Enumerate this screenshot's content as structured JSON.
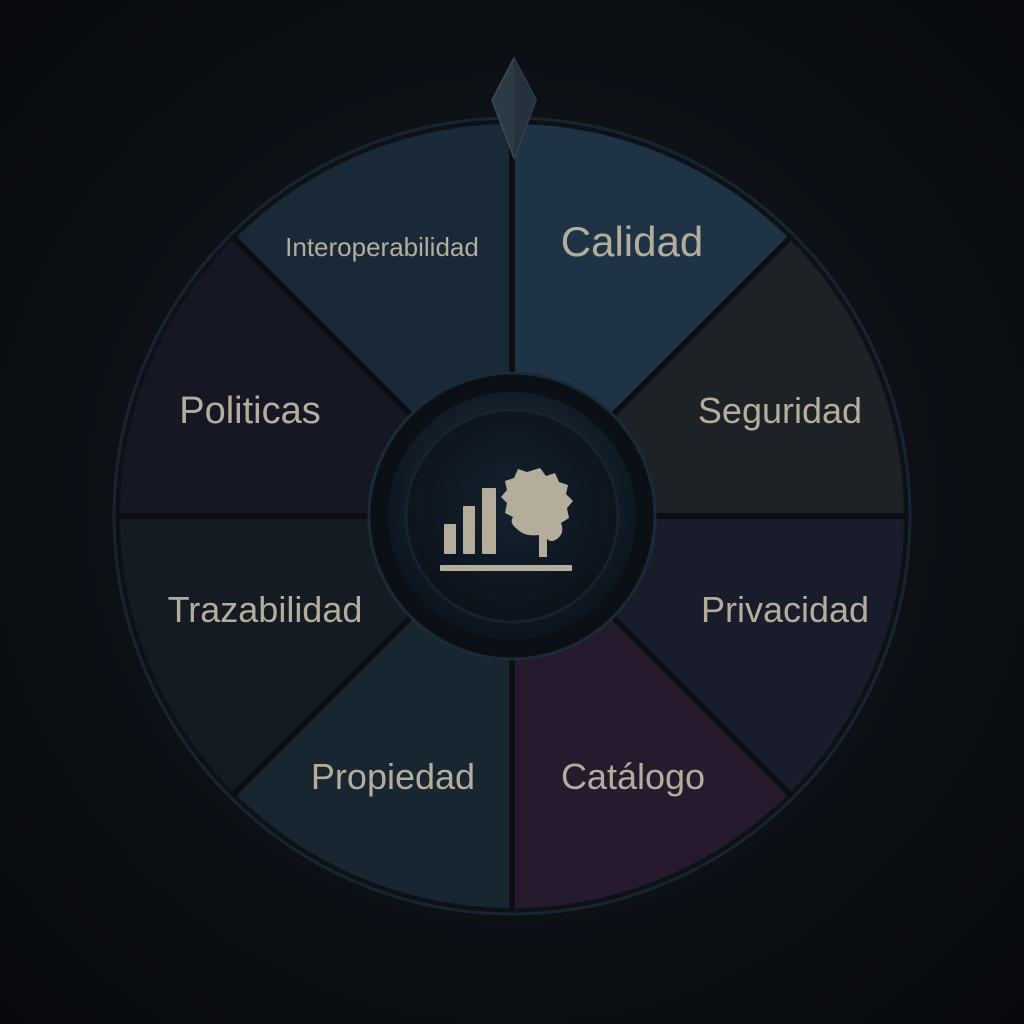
{
  "wheel": {
    "pointer_icon": "pointer-arrow-icon",
    "center_icon": "analytics-brain-gear-icon",
    "segments": [
      {
        "label": "Calidad",
        "color": "#1f3346"
      },
      {
        "label": "Seguridad",
        "color": "#1d2227"
      },
      {
        "label": "Privacidad",
        "color": "#191c2b"
      },
      {
        "label": "Catálogo",
        "color": "#261a2e"
      },
      {
        "label": "Propiedad",
        "color": "#172630"
      },
      {
        "label": "Trazabilidad",
        "color": "#141b22"
      },
      {
        "label": "Politicas",
        "color": "#161724"
      },
      {
        "label": "Interoperabilidad",
        "color": "#1a2938"
      }
    ],
    "colors": {
      "background": "#0a0d12",
      "label": "#b5ad9c",
      "divider": "#0b0f14",
      "hub": "#0e161e",
      "icon": "#b5ad9c"
    }
  }
}
